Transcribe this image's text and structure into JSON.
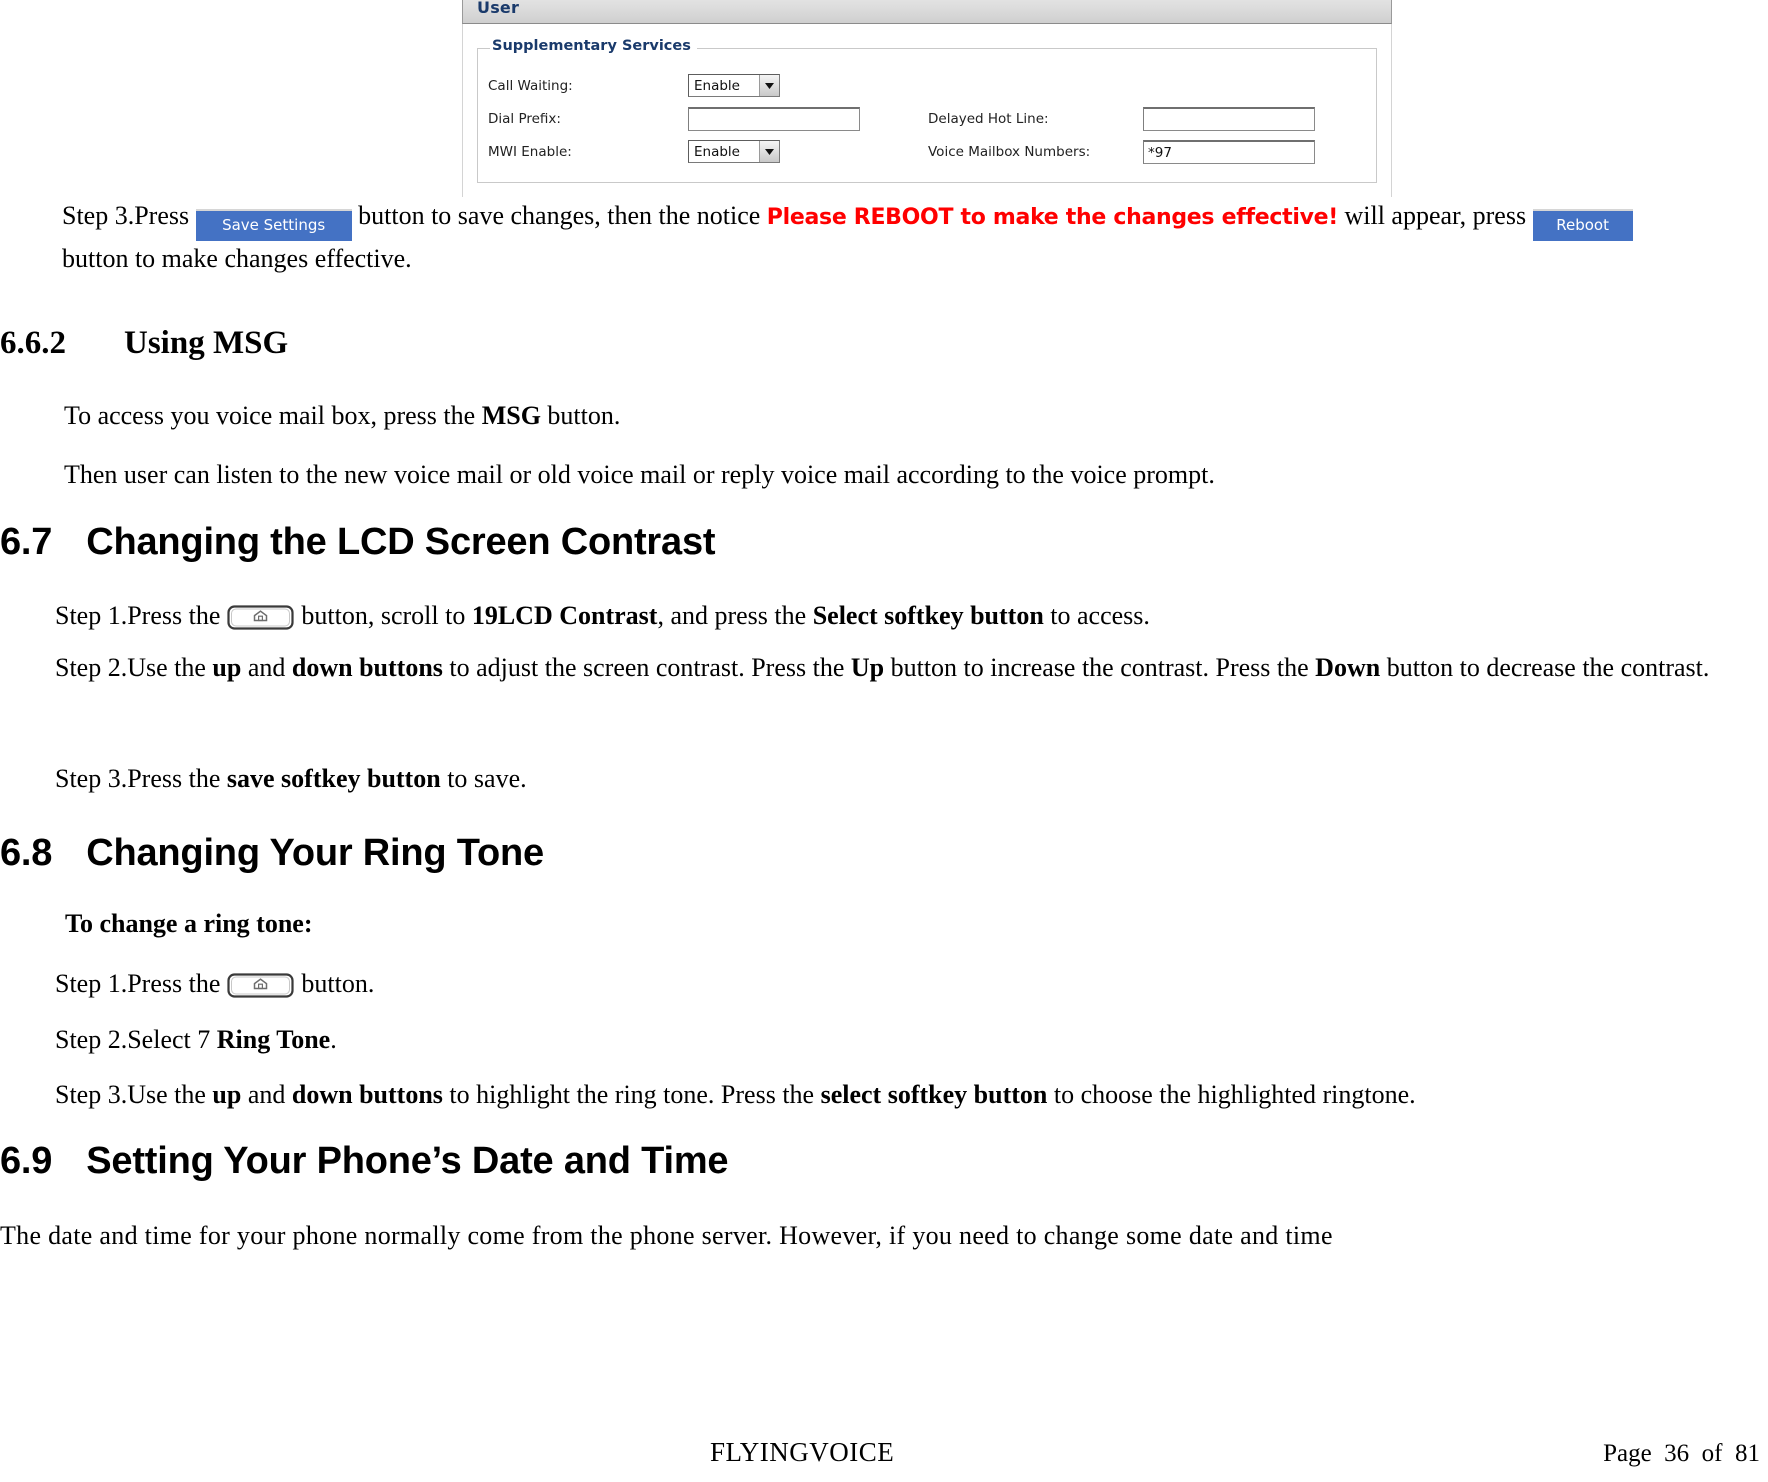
{
  "figure": {
    "title": "User",
    "fieldset_legend": "Supplementary Services",
    "fields": [
      {
        "label": "Call Waiting:",
        "type": "select",
        "value": "Enable"
      },
      {
        "label": "Dial Prefix:",
        "type": "text",
        "value": ""
      },
      {
        "label": "Delayed Hot Line:",
        "type": "text",
        "value": ""
      },
      {
        "label": "MWI Enable:",
        "type": "select",
        "value": "Enable"
      },
      {
        "label": "Voice Mailbox Numbers:",
        "type": "text",
        "value": "*97"
      }
    ]
  },
  "step3_save": {
    "prefix": "Step  3.Press ",
    "save_button_label": "Save Settings",
    "middle": " button  to  save  changes,  then  the  notice ",
    "notice": "Please REBOOT to make the changes effective!",
    "after_notice": " will  appear,  press ",
    "reboot_button_label": "Reboot",
    "tail": "button to make changes effective."
  },
  "section_662": {
    "number": "6.6.2",
    "title": "Using MSG",
    "line1_a": "To access you voice mail box, press the ",
    "line1_bold": "MSG",
    "line1_b": " button.",
    "line2": "Then user can listen to the new voice mail or old voice mail or reply voice mail according to the voice prompt."
  },
  "section_67": {
    "number": "6.7",
    "title": "Changing the LCD Screen Contrast",
    "step1_a": "Step 1.Press the ",
    "step1_icon": "home-key-icon",
    "step1_b": " button, scroll to ",
    "step1_bold1": "19LCD Contrast",
    "step1_c": ", and press the ",
    "step1_bold2": "Select softkey button",
    "step1_d": " to access.",
    "step2_a": "Step 2.Use the ",
    "step2_bold1": "up",
    "step2_b": " and ",
    "step2_bold2": "down buttons",
    "step2_c": " to adjust the screen contrast. Press the ",
    "step2_bold3": "Up",
    "step2_d": " button to increase the contrast. Press the ",
    "step2_bold4": "Down",
    "step2_e": " button to decrease the contrast.",
    "step3_a": "Step 3.Press the ",
    "step3_bold": "save softkey button",
    "step3_b": " to save."
  },
  "section_68": {
    "number": "6.8",
    "title": "Changing Your Ring Tone",
    "intro_bold": "To change a ring tone:",
    "step1_a": "Step 1.Press the ",
    "step1_icon": "home-key-icon",
    "step1_b": " button.",
    "step2_a": "Step 2.Select 7 ",
    "step2_bold": "Ring Tone",
    "step2_b": ".",
    "step3_a": "Step 3.Use the ",
    "step3_bold1": "up",
    "step3_b": " and ",
    "step3_bold2": "down buttons",
    "step3_c": " to highlight the ring tone. Press the ",
    "step3_bold3": "select softkey button",
    "step3_d": " to choose the highlighted ringtone."
  },
  "section_69": {
    "number": "6.9",
    "title": "Setting Your Phone’s Date and Time",
    "paragraph": "The date and time  for your  phone normally come from the phone server. However, if you need to change some date and time"
  },
  "footer": {
    "brand": "FLYINGVOICE",
    "page": "Page  36  of  81"
  },
  "colors": {
    "button_blue": "#4472c4",
    "notice_red": "#ff0000",
    "legend_blue": "#1a3a6b"
  }
}
